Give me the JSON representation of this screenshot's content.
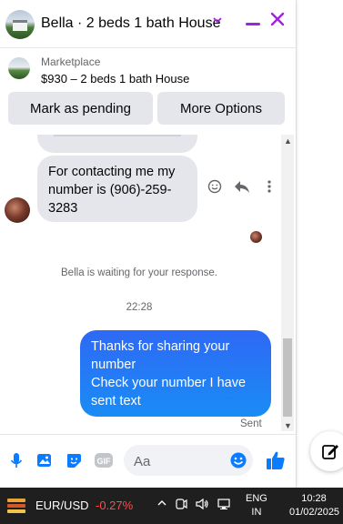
{
  "header": {
    "title": "Bella · 2 beds 1 bath House",
    "icons": [
      "chevron-down-icon",
      "minimize-icon",
      "close-icon"
    ]
  },
  "marketplace": {
    "label": "Marketplace",
    "listing": "$930 – 2 beds 1 bath House",
    "buttons": {
      "pending": "Mark as pending",
      "more": "More Options"
    }
  },
  "messages": {
    "incoming_text": "For contacting me my number is (906)-259-3283",
    "waiting_text": "Bella is waiting for your response.",
    "timestamp": "22:28",
    "outgoing_text": "Thanks for sharing your number\nCheck your number I have sent text",
    "status": "Sent"
  },
  "composer": {
    "placeholder": "Aa",
    "icons": [
      "microphone-icon",
      "photo-icon",
      "sticker-icon",
      "gif-icon",
      "emoji-icon",
      "like-icon"
    ]
  },
  "taskbar": {
    "pair": "EUR/USD",
    "change": "-0.27%",
    "lang_line1": "ENG",
    "lang_line2": "IN",
    "time": "10:28",
    "date": "01/02/2025"
  },
  "colors": {
    "accent_purple": "#a41fe6",
    "messenger_blue": "#0a7cff",
    "negative_red": "#ff4d4d"
  }
}
